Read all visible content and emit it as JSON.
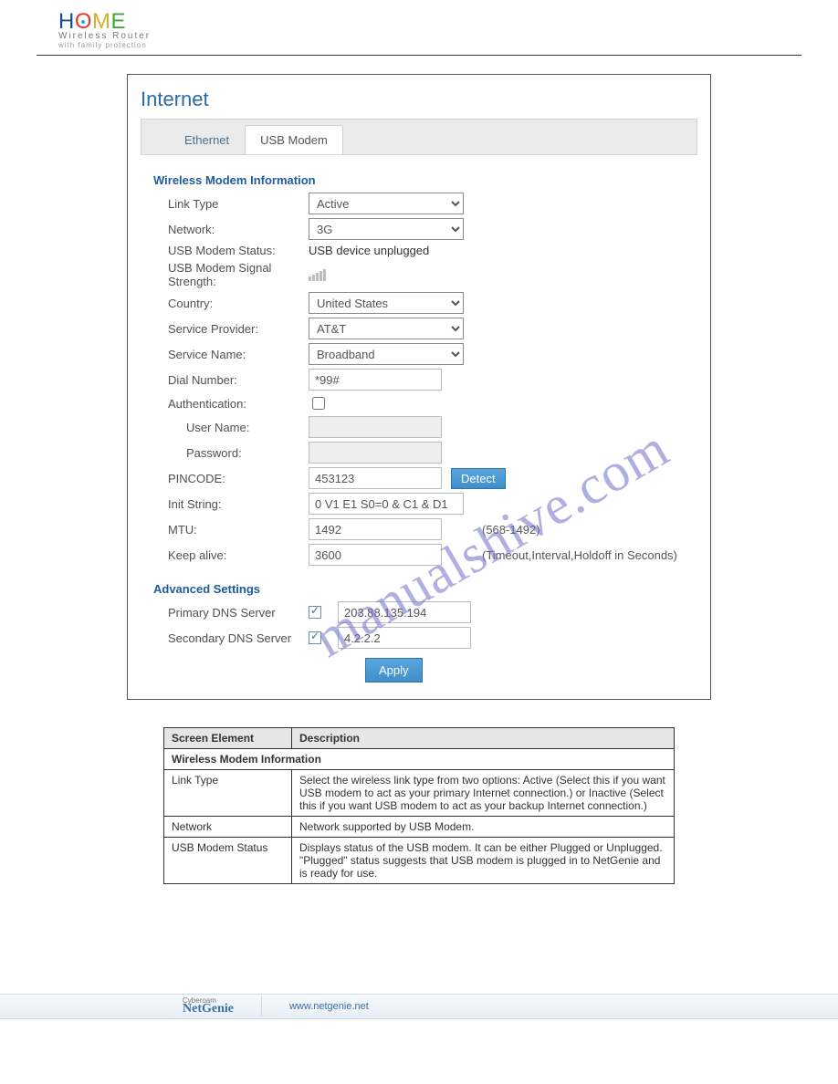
{
  "logo": {
    "letters": [
      "H",
      "O",
      "M",
      "E"
    ],
    "sub1": "Wireless Router",
    "sub2": "with family protection"
  },
  "watermark": "manualshive.com",
  "panel": {
    "title": "Internet",
    "tabs": [
      {
        "label": "Ethernet",
        "active": false
      },
      {
        "label": "USB Modem",
        "active": true
      }
    ]
  },
  "wireless": {
    "heading": "Wireless Modem Information",
    "link_type_lbl": "Link Type",
    "link_type_val": "Active",
    "network_lbl": "Network:",
    "network_val": "3G",
    "status_lbl": "USB Modem Status:",
    "status_val": "USB device unplugged",
    "signal_lbl": "USB Modem Signal Strength:",
    "country_lbl": "Country:",
    "country_val": "United States",
    "provider_lbl": "Service Provider:",
    "provider_val": "AT&T",
    "service_name_lbl": "Service Name:",
    "service_name_val": "Broadband",
    "dial_lbl": "Dial Number:",
    "dial_val": "*99#",
    "auth_lbl": "Authentication:",
    "user_lbl": "User Name:",
    "user_val": "",
    "pass_lbl": "Password:",
    "pass_val": "",
    "pin_lbl": "PINCODE:",
    "pin_val": "453123",
    "detect_btn": "Detect",
    "init_lbl": "Init String:",
    "init_val": "0 V1 E1 S0=0 & C1 & D1",
    "mtu_lbl": "MTU:",
    "mtu_val": "1492",
    "mtu_hint": "(568-1492)",
    "keep_lbl": "Keep alive:",
    "keep_val": "3600",
    "keep_hint": "(Timeout,Interval,Holdoff in Seconds)"
  },
  "advanced": {
    "heading": "Advanced Settings",
    "primary_lbl": "Primary DNS Server",
    "primary_val": "203.88.135.194",
    "secondary_lbl": "Secondary DNS Server",
    "secondary_val": "4.2.2.2",
    "apply_btn": "Apply"
  },
  "desc_table": {
    "header": [
      "Screen Element",
      "Description"
    ],
    "section": "Wireless Modem Information",
    "rows": [
      {
        "label": "Link Type",
        "desc": "Select the wireless link type from two options: Active (Select this if you want USB modem to act as your primary Internet connection.) or Inactive (Select this if you want USB modem to act as your backup Internet connection.)"
      },
      {
        "label": "Network",
        "desc": "Network supported by USB Modem."
      },
      {
        "label": "USB Modem Status",
        "desc": "Displays status of the USB modem. It can be either Plugged or Unplugged. \"Plugged\" status suggests that USB modem is plugged in to NetGenie and is ready for use."
      }
    ]
  },
  "footer": {
    "brand_sup": "Cyberoam",
    "brand": "NetGenie",
    "url": "www.netgenie.net"
  }
}
